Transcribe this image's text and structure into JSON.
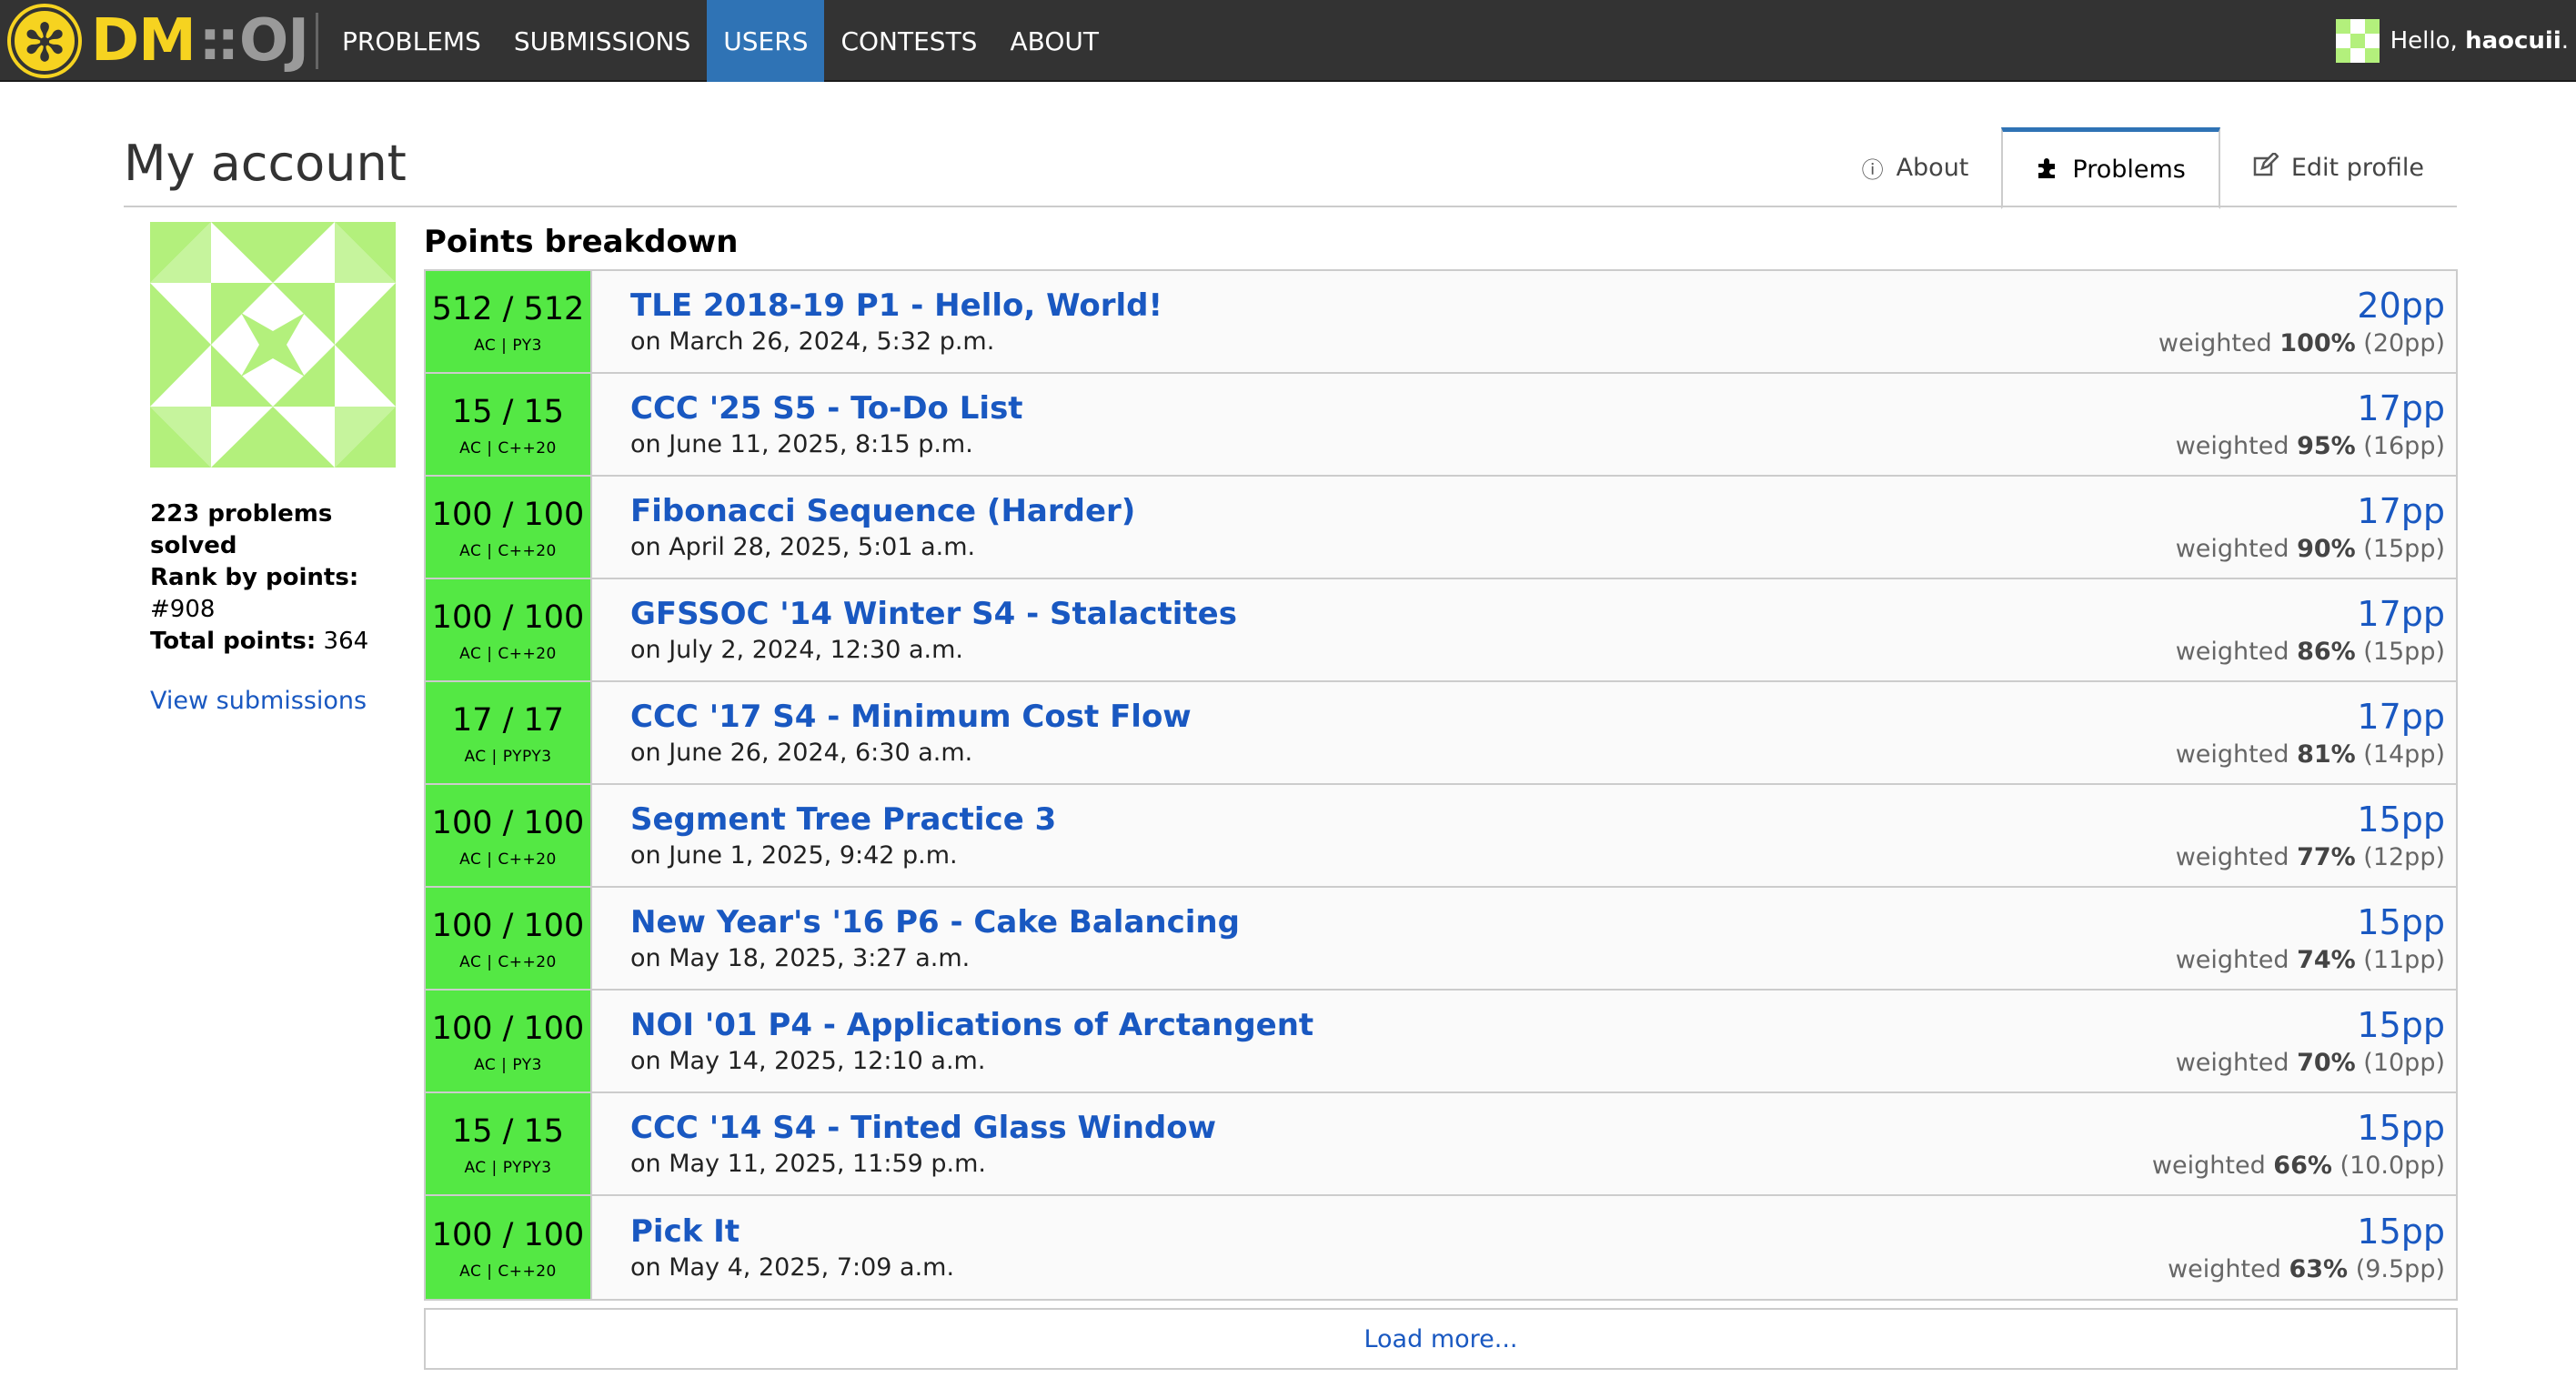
{
  "navbar": {
    "logo_dm": "DM",
    "logo_sep": "::",
    "logo_oj": "OJ",
    "items": [
      {
        "label": "PROBLEMS",
        "active": false
      },
      {
        "label": "SUBMISSIONS",
        "active": false
      },
      {
        "label": "USERS",
        "active": true
      },
      {
        "label": "CONTESTS",
        "active": false
      },
      {
        "label": "ABOUT",
        "active": false
      }
    ],
    "hello_prefix": "Hello, ",
    "username": "haocuii",
    "hello_suffix": "."
  },
  "page": {
    "title": "My account",
    "tabs": [
      {
        "label": "About",
        "icon": "info-circle-icon",
        "active": false
      },
      {
        "label": "Problems",
        "icon": "puzzle-icon",
        "active": true
      },
      {
        "label": "Edit profile",
        "icon": "edit-icon",
        "active": false
      }
    ]
  },
  "sidebar": {
    "problems_solved": "223 problems solved",
    "rank_label": "Rank by points:",
    "rank_value": " #908",
    "total_label": "Total points:",
    "total_value": " 364",
    "view_submissions": "View submissions"
  },
  "breakdown": {
    "title": "Points breakdown",
    "rows": [
      {
        "score": "512 / 512",
        "status": "AC | PY3",
        "name": "TLE 2018-19 P1 - Hello, World!",
        "date": "on March 26, 2024, 5:32 p.m.",
        "points": "20pp",
        "weight_pct": "100%",
        "weight_pp": "(20pp)"
      },
      {
        "score": "15 / 15",
        "status": "AC | C++20",
        "name": "CCC '25 S5 - To-Do List",
        "date": "on June 11, 2025, 8:15 p.m.",
        "points": "17pp",
        "weight_pct": "95%",
        "weight_pp": "(16pp)"
      },
      {
        "score": "100 / 100",
        "status": "AC | C++20",
        "name": "Fibonacci Sequence (Harder)",
        "date": "on April 28, 2025, 5:01 a.m.",
        "points": "17pp",
        "weight_pct": "90%",
        "weight_pp": "(15pp)"
      },
      {
        "score": "100 / 100",
        "status": "AC | C++20",
        "name": "GFSSOC '14 Winter S4 - Stalactites",
        "date": "on July 2, 2024, 12:30 a.m.",
        "points": "17pp",
        "weight_pct": "86%",
        "weight_pp": "(15pp)"
      },
      {
        "score": "17 / 17",
        "status": "AC | PYPY3",
        "name": "CCC '17 S4 - Minimum Cost Flow",
        "date": "on June 26, 2024, 6:30 a.m.",
        "points": "17pp",
        "weight_pct": "81%",
        "weight_pp": "(14pp)"
      },
      {
        "score": "100 / 100",
        "status": "AC | C++20",
        "name": "Segment Tree Practice 3",
        "date": "on June 1, 2025, 9:42 p.m.",
        "points": "15pp",
        "weight_pct": "77%",
        "weight_pp": "(12pp)"
      },
      {
        "score": "100 / 100",
        "status": "AC | C++20",
        "name": "New Year's '16 P6 - Cake Balancing",
        "date": "on May 18, 2025, 3:27 a.m.",
        "points": "15pp",
        "weight_pct": "74%",
        "weight_pp": "(11pp)"
      },
      {
        "score": "100 / 100",
        "status": "AC | PY3",
        "name": "NOI '01 P4 - Applications of Arctangent",
        "date": "on May 14, 2025, 12:10 a.m.",
        "points": "15pp",
        "weight_pct": "70%",
        "weight_pp": "(10pp)"
      },
      {
        "score": "15 / 15",
        "status": "AC | PYPY3",
        "name": "CCC '14 S4 - Tinted Glass Window",
        "date": "on May 11, 2025, 11:59 p.m.",
        "points": "15pp",
        "weight_pct": "66%",
        "weight_pp": "(10.0pp)"
      },
      {
        "score": "100 / 100",
        "status": "AC | C++20",
        "name": "Pick It",
        "date": "on May 4, 2025, 7:09 a.m.",
        "points": "15pp",
        "weight_pct": "63%",
        "weight_pp": "(9.5pp)"
      }
    ],
    "weighted_label": "weighted ",
    "load_more": "Load more..."
  },
  "colors": {
    "navbar_bg": "#333333",
    "nav_active": "#2f73b5",
    "logo_yellow": "#f6d320",
    "ac_green": "#54e844",
    "link_blue": "#1958c1",
    "avatar_green": "#b3f07c"
  }
}
